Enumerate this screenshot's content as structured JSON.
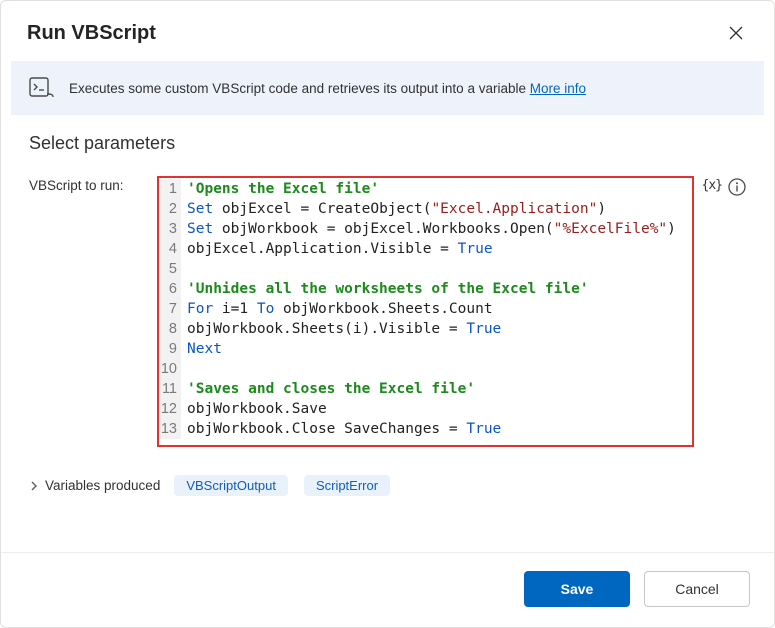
{
  "header": {
    "title": "Run VBScript"
  },
  "banner": {
    "text": "Executes some custom VBScript code and retrieves its output into a variable ",
    "more_info_label": "More info"
  },
  "params": {
    "section_title": "Select parameters",
    "label": "VBScript to run:",
    "code_lines": [
      {
        "n": 1,
        "tokens": [
          {
            "t": "'Opens the Excel file'",
            "c": "cm"
          }
        ]
      },
      {
        "n": 2,
        "tokens": [
          {
            "t": "Set",
            "c": "kw"
          },
          {
            "t": " objExcel = CreateObject(",
            "c": "txt"
          },
          {
            "t": "\"Excel.Application\"",
            "c": "str"
          },
          {
            "t": ")",
            "c": "txt"
          }
        ]
      },
      {
        "n": 3,
        "tokens": [
          {
            "t": "Set",
            "c": "kw"
          },
          {
            "t": " objWorkbook = objExcel.Workbooks.Open(",
            "c": "txt"
          },
          {
            "t": "\"%ExcelFile%\"",
            "c": "str"
          },
          {
            "t": ")",
            "c": "txt"
          }
        ]
      },
      {
        "n": 4,
        "tokens": [
          {
            "t": "objExcel.Application.Visible = ",
            "c": "txt"
          },
          {
            "t": "True",
            "c": "kwb"
          }
        ]
      },
      {
        "n": 5,
        "tokens": [
          {
            "t": "",
            "c": "txt"
          }
        ]
      },
      {
        "n": 6,
        "tokens": [
          {
            "t": "'Unhides all the worksheets of the Excel file'",
            "c": "cm"
          }
        ]
      },
      {
        "n": 7,
        "tokens": [
          {
            "t": "For",
            "c": "kw"
          },
          {
            "t": " i=1 ",
            "c": "txt"
          },
          {
            "t": "To",
            "c": "kw"
          },
          {
            "t": " objWorkbook.Sheets.Count",
            "c": "txt"
          }
        ]
      },
      {
        "n": 8,
        "tokens": [
          {
            "t": "objWorkbook.Sheets(i).Visible = ",
            "c": "txt"
          },
          {
            "t": "True",
            "c": "kwb"
          }
        ]
      },
      {
        "n": 9,
        "tokens": [
          {
            "t": "Next",
            "c": "kw"
          }
        ]
      },
      {
        "n": 10,
        "tokens": [
          {
            "t": "",
            "c": "txt"
          }
        ]
      },
      {
        "n": 11,
        "tokens": [
          {
            "t": "'Saves and closes the Excel file'",
            "c": "cm"
          }
        ]
      },
      {
        "n": 12,
        "tokens": [
          {
            "t": "objWorkbook.Save",
            "c": "txt"
          }
        ]
      },
      {
        "n": 13,
        "tokens": [
          {
            "t": "objWorkbook.Close SaveChanges = ",
            "c": "txt"
          },
          {
            "t": "True",
            "c": "kwb"
          }
        ]
      }
    ],
    "var_picker_glyph": "{x}"
  },
  "produced": {
    "label": "Variables produced",
    "chips": [
      "VBScriptOutput",
      "ScriptError"
    ]
  },
  "footer": {
    "save_label": "Save",
    "cancel_label": "Cancel"
  }
}
